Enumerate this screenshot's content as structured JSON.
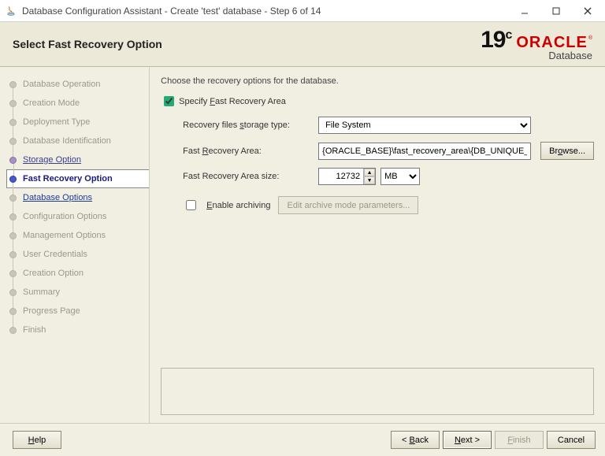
{
  "window": {
    "title": "Database Configuration Assistant - Create 'test' database - Step 6 of 14"
  },
  "header": {
    "heading": "Select Fast Recovery Option",
    "brand_version_num": "19",
    "brand_version_sup": "c",
    "brand_name": "ORACLE",
    "brand_sub": "Database"
  },
  "steps": [
    {
      "label": "Database Operation",
      "state": "disabled"
    },
    {
      "label": "Creation Mode",
      "state": "disabled"
    },
    {
      "label": "Deployment Type",
      "state": "disabled"
    },
    {
      "label": "Database Identification",
      "state": "disabled"
    },
    {
      "label": "Storage Option",
      "state": "done"
    },
    {
      "label": "Fast Recovery Option",
      "state": "current"
    },
    {
      "label": "Database Options",
      "state": "next"
    },
    {
      "label": "Configuration Options",
      "state": "disabled"
    },
    {
      "label": "Management Options",
      "state": "disabled"
    },
    {
      "label": "User Credentials",
      "state": "disabled"
    },
    {
      "label": "Creation Option",
      "state": "disabled"
    },
    {
      "label": "Summary",
      "state": "disabled"
    },
    {
      "label": "Progress Page",
      "state": "disabled"
    },
    {
      "label": "Finish",
      "state": "disabled"
    }
  ],
  "main": {
    "description": "Choose the recovery options for the database.",
    "specify_fra_label": "Specify Fast Recovery Area",
    "specify_fra_checked": true,
    "storage_type_label": "Recovery files storage type:",
    "storage_type_value": "File System",
    "fra_path_label": "Fast Recovery Area:",
    "fra_path_value": "{ORACLE_BASE}\\fast_recovery_area\\{DB_UNIQUE_NAME}",
    "browse_label": "Browse...",
    "fra_size_label": "Fast Recovery Area size:",
    "fra_size_value": "12732",
    "fra_size_unit": "MB",
    "enable_archive_label": "Enable archiving",
    "enable_archive_checked": false,
    "edit_archive_label": "Edit archive mode parameters..."
  },
  "footer": {
    "help": "Help",
    "back": "< Back",
    "next": "Next >",
    "finish": "Finish",
    "cancel": "Cancel"
  }
}
